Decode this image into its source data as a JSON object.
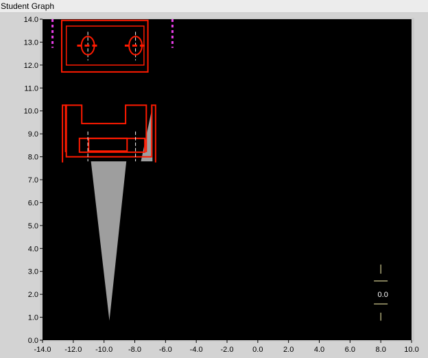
{
  "window": {
    "title": "Student Graph"
  },
  "chart_data": {
    "type": "scatter",
    "title": "",
    "xlabel": "",
    "ylabel": "",
    "xlim": [
      -14.0,
      10.0
    ],
    "ylim": [
      0.0,
      14.0
    ],
    "x_ticks": [
      "-14.0",
      "-12.0",
      "-10.0",
      "-8.0",
      "-6.0",
      "-4.0",
      "-2.0",
      "0.0",
      "2.0",
      "4.0",
      "6.0",
      "8.0",
      "10.0"
    ],
    "y_ticks": [
      "0.0",
      "1.0",
      "2.0",
      "3.0",
      "4.0",
      "5.0",
      "6.0",
      "7.0",
      "8.0",
      "9.0",
      "10.0",
      "11.0",
      "12.0",
      "13.0",
      "14.0"
    ],
    "background": "#000000",
    "colors": {
      "outline": "#ff1a00",
      "cone": "#9e9e9e",
      "marker": "#e83ee8",
      "indicator": "#fff9b0",
      "center_line": "#ffffff"
    },
    "shapes": {
      "top_block_outer": [
        [
          -12.75,
          11.7
        ],
        [
          -7.15,
          11.7
        ],
        [
          -7.15,
          13.95
        ],
        [
          -12.75,
          13.95
        ]
      ],
      "top_block_inner": [
        [
          -12.45,
          12.0
        ],
        [
          -7.4,
          12.0
        ],
        [
          -7.4,
          13.7
        ],
        [
          -12.45,
          13.7
        ]
      ],
      "holes": [
        {
          "cx": -11.05,
          "cy": 12.85,
          "rx": 0.42,
          "ry": 0.4
        },
        {
          "cx": -7.95,
          "cy": 12.85,
          "rx": 0.42,
          "ry": 0.4
        }
      ],
      "bottom_outer": [
        [
          -12.7,
          7.75
        ],
        [
          -12.7,
          10.25
        ],
        [
          -12.45,
          10.25
        ],
        [
          -12.45,
          8.0
        ],
        [
          -6.9,
          8.0
        ],
        [
          -6.9,
          10.25
        ],
        [
          -6.65,
          10.25
        ],
        [
          -6.65,
          7.75
        ]
      ],
      "bottom_inner_u": [
        [
          -12.5,
          8.2
        ],
        [
          -12.5,
          10.25
        ],
        [
          -11.45,
          10.25
        ],
        [
          -11.45,
          9.45
        ],
        [
          -8.6,
          9.45
        ],
        [
          -8.6,
          10.25
        ],
        [
          -7.25,
          10.25
        ],
        [
          -7.25,
          8.2
        ]
      ],
      "bar_outer": [
        [
          -11.6,
          8.2
        ],
        [
          -11.6,
          8.8
        ],
        [
          -7.35,
          8.8
        ],
        [
          -7.35,
          8.2
        ]
      ],
      "bar_inner": [
        [
          -11.0,
          8.25
        ],
        [
          -11.0,
          8.8
        ],
        [
          -8.5,
          8.8
        ],
        [
          -8.5,
          8.25
        ]
      ],
      "cone": [
        [
          -10.85,
          7.8
        ],
        [
          -8.55,
          7.8
        ],
        [
          -9.65,
          0.85
        ]
      ],
      "right_wedge": [
        [
          -6.85,
          10.2
        ],
        [
          -6.85,
          7.8
        ],
        [
          -7.6,
          7.8
        ]
      ],
      "center_lines_x": [
        -11.05,
        -7.95
      ],
      "marker_lines_x": [
        -13.35,
        -5.55
      ],
      "indicator": {
        "x": 8.0,
        "value": "0.0"
      }
    }
  }
}
